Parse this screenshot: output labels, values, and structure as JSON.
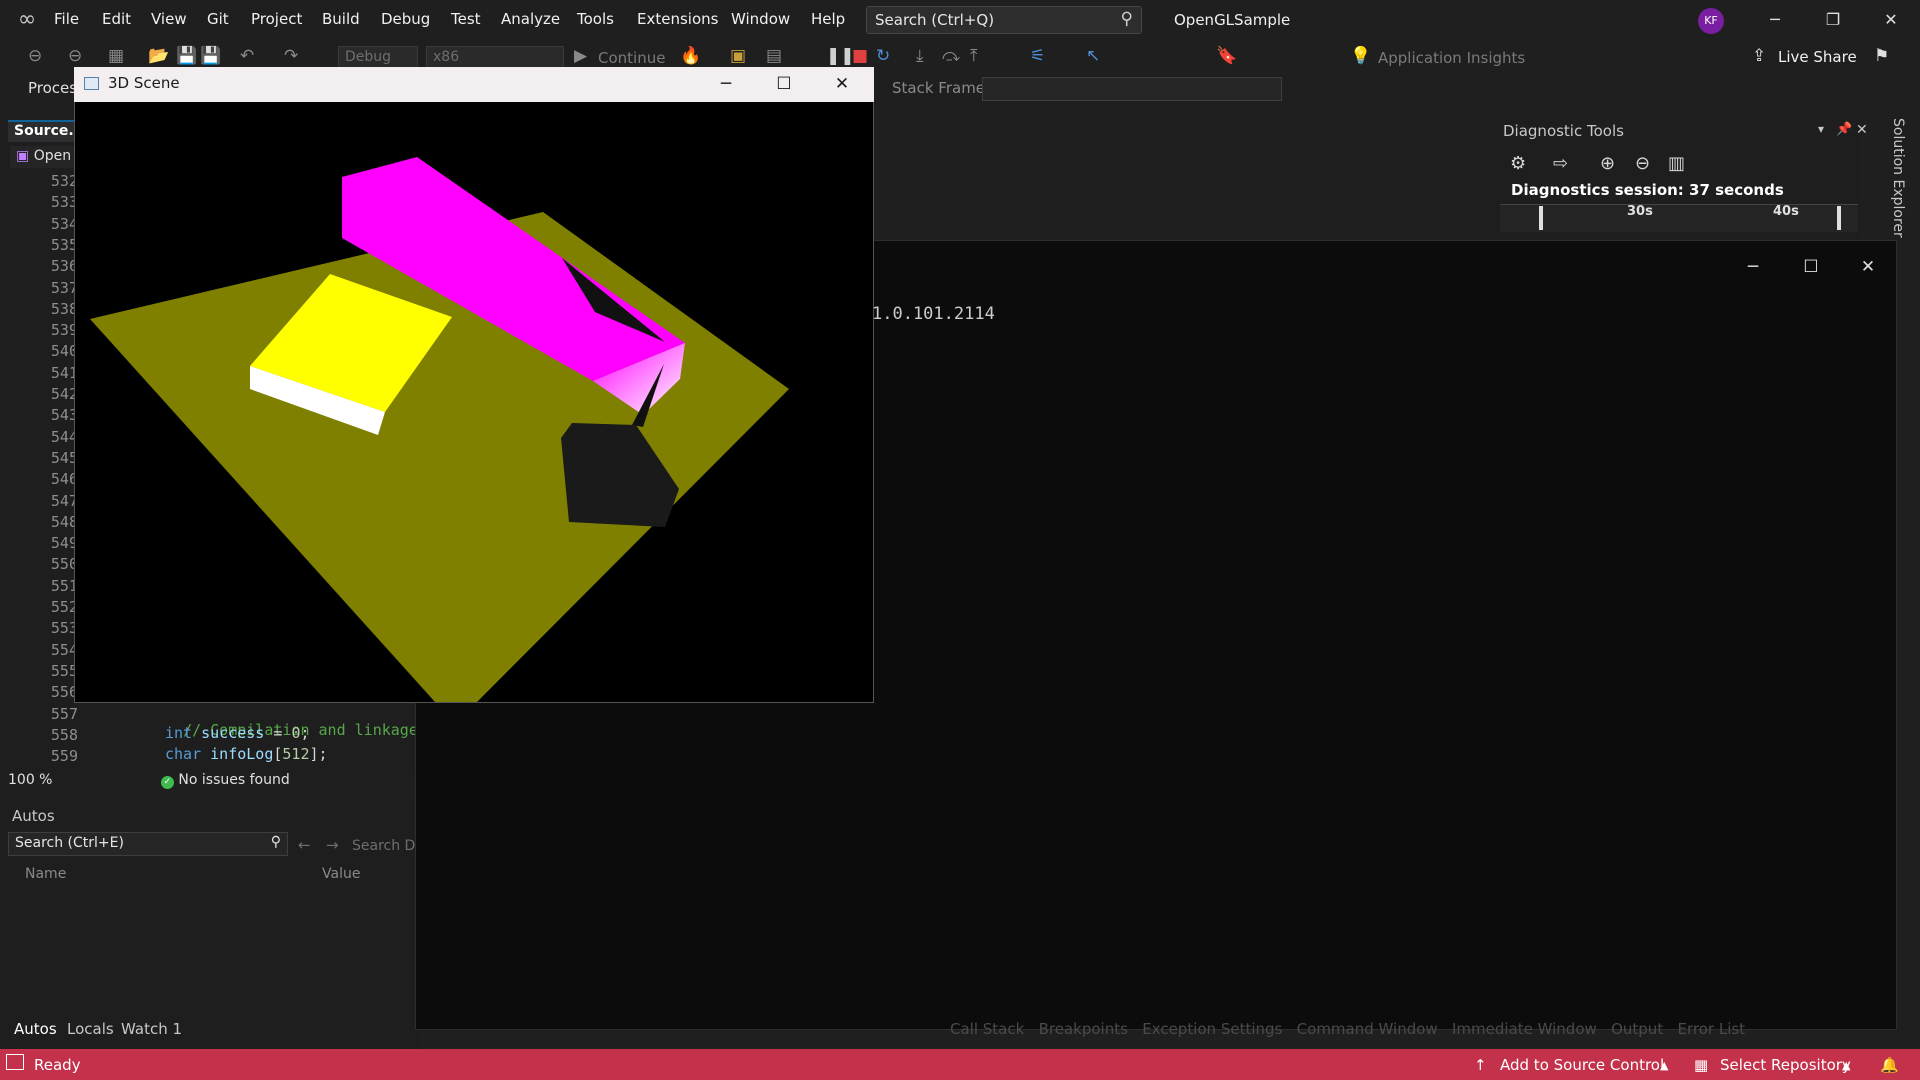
{
  "menubar": {
    "items": [
      "File",
      "Edit",
      "View",
      "Git",
      "Project",
      "Build",
      "Debug",
      "Test",
      "Analyze",
      "Tools",
      "Extensions",
      "Window",
      "Help"
    ],
    "search_placeholder": "Search (Ctrl+Q)",
    "solution_name": "OpenGLSample",
    "avatar_initials": "KF"
  },
  "toolbar": {
    "config": "Debug",
    "platform": "x86",
    "continue_label": "Continue",
    "app_insights": "Application Insights",
    "live_share": "Live Share"
  },
  "debugbar": {
    "process_label": "Proces",
    "stack_frame_label": "Stack Frame:"
  },
  "editor": {
    "tab_label": "Source.c",
    "nav_combo": "Open",
    "line_numbers": [
      "532",
      "533",
      "534",
      "535",
      "536",
      "537",
      "538",
      "539",
      "540",
      "541",
      "542",
      "543",
      "544",
      "545",
      "546",
      "547",
      "548",
      "549",
      "550",
      "551",
      "552",
      "553",
      "554",
      "555",
      "556",
      "557",
      "558",
      "559"
    ],
    "code": {
      "l557": "// Compilation and linkage",
      "l558_kw": "int",
      "l558_id": "success",
      "l558_rest": " = ",
      "l558_num": "0",
      "l558_end": ";",
      "l559_kw": "char",
      "l559_id": "infoLog",
      "l559_open": "[",
      "l559_num": "512",
      "l559_end": "];"
    },
    "zoom": "100 %",
    "issues": "No issues found"
  },
  "autos": {
    "title": "Autos",
    "search_placeholder": "Search (Ctrl+E)",
    "search_depth": "Search De",
    "col_name": "Name",
    "col_value": "Value",
    "tabs": [
      "Autos",
      "Locals",
      "Watch 1"
    ]
  },
  "console": {
    "text": "1.0.101.2114",
    "ghost_tabs": [
      "Call Stack",
      "Breakpoints",
      "Exception Settings",
      "Command Window",
      "Immediate Window",
      "Output",
      "Error List"
    ]
  },
  "diagnostics": {
    "title": "Diagnostic Tools",
    "session": "Diagnostics session: 37 seconds",
    "ticks": [
      "30s",
      "40s"
    ]
  },
  "side_panel": {
    "solution_explorer": "Solution Explorer"
  },
  "scene_window": {
    "title": "3D Scene",
    "colors": {
      "floor": "#808000",
      "magenta": "#ff00ff",
      "yellow": "#ffff00",
      "dark_cube": "#1a1a1a"
    }
  },
  "statusbar": {
    "ready": "Ready",
    "source_control": "Add to Source Control",
    "repository": "Select Repository",
    "color": "#c4314b"
  }
}
